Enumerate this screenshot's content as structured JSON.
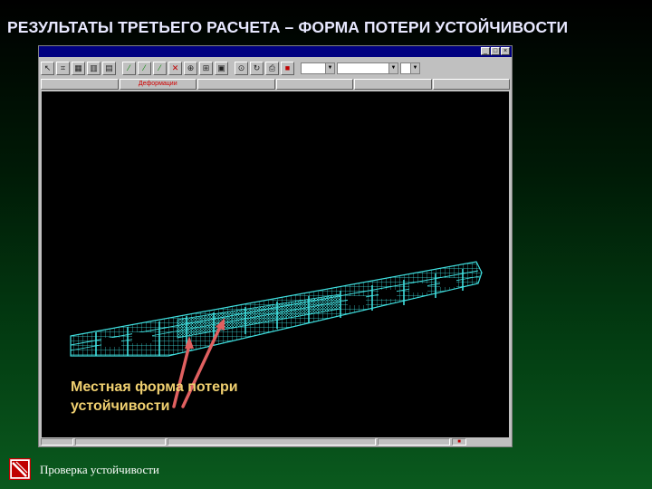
{
  "slide": {
    "title": "РЕЗУЛЬТАТЫ ТРЕТЬЕГО РАСЧЕТА – ФОРМА ПОТЕРИ УСТОЙЧИВОСТИ",
    "annotation_line1": "Местная форма потери",
    "annotation_line2": "устойчивости",
    "footer_text": "Проверка устойчивости"
  },
  "window": {
    "title": "",
    "tabs": [
      {
        "label": "",
        "active": false
      },
      {
        "label": "Деформации",
        "active": true
      },
      {
        "label": "",
        "active": false
      },
      {
        "label": "",
        "active": false
      },
      {
        "label": "",
        "active": false
      },
      {
        "label": "",
        "active": false
      }
    ],
    "toolbar_icons": [
      "pointer-icon",
      "select-icon",
      "grid-icon",
      "mesh-icon",
      "frame-icon",
      "wand-icon",
      "wand-icon",
      "wand-icon",
      "cross-icon",
      "load-icon",
      "node-icon",
      "table-icon",
      "zoom-icon",
      "rotate-icon",
      "print-icon",
      "stop-icon"
    ],
    "combo1": "",
    "combo2": "",
    "combo3": ""
  },
  "colors": {
    "title_text": "#e8e8ff",
    "annotation_text": "#f0d070",
    "model_wire": "#40e0e0",
    "arrow": "#e06060",
    "active_tab": "#d00000",
    "background_bottom": "#0a5a1e"
  }
}
